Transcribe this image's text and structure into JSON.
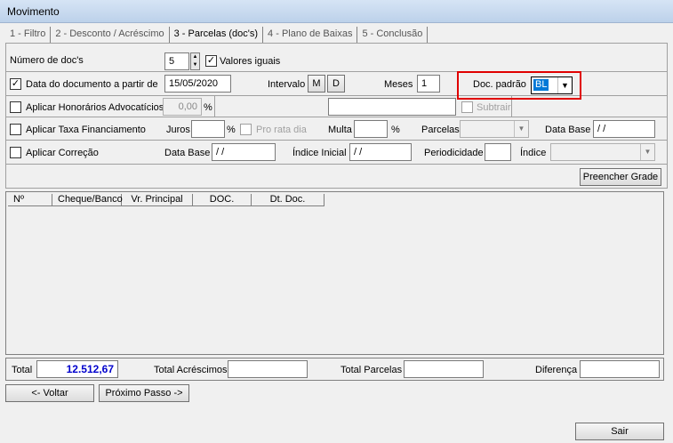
{
  "window": {
    "title": "Movimento"
  },
  "tabs": [
    {
      "label": "1 - Filtro"
    },
    {
      "label": "2 - Desconto / Acréscimo"
    },
    {
      "label": "3 - Parcelas (doc's)"
    },
    {
      "label": "4 - Plano de Baixas"
    },
    {
      "label": "5 - Conclusão"
    }
  ],
  "row1": {
    "num_docs_label": "Número de doc's",
    "num_docs_value": "5",
    "valores_iguais_label": "Valores iguais",
    "check_mark": "✓"
  },
  "row2": {
    "data_doc_label": "Data do documento a partir de",
    "data_doc_value": "15/05/2020",
    "intervalo_label": "Intervalo",
    "m_button": "M",
    "d_button": "D",
    "meses_label": "Meses",
    "meses_value": "1",
    "doc_padrao_label": "Doc. padrão",
    "doc_padrao_value": "BL"
  },
  "row3": {
    "honorarios_label": "Aplicar Honorários Advocatícios",
    "honorarios_value": "0,00",
    "percent": "%",
    "subtrair_label": "Subtrair"
  },
  "row4": {
    "taxa_label": "Aplicar Taxa Financiamento",
    "juros_label": "Juros",
    "percent": "%",
    "pro_rata_label": "Pro rata dia",
    "multa_label": "Multa",
    "parcelas_label": "Parcelas",
    "data_base_label": "Data Base",
    "data_base_value": " / /"
  },
  "row5": {
    "correcao_label": "Aplicar Correção",
    "data_base_label": "Data Base",
    "data_base_value": " / /",
    "indice_inicial_label": "Índice Inicial",
    "indice_inicial_value": " / /",
    "periodicidade_label": "Periodicidade",
    "indice_label": "Índice"
  },
  "preencher_button": "Preencher Grade",
  "grid": {
    "columns": [
      "Nº",
      "Cheque/Banco",
      "Vr. Principal",
      "DOC.",
      "Dt. Doc."
    ]
  },
  "totals": {
    "total_label": "Total",
    "total_value": "12.512,67",
    "acrescimos_label": "Total Acréscimos",
    "parcelas_label": "Total Parcelas",
    "diferenca_label": "Diferença"
  },
  "nav": {
    "voltar": "<- Voltar",
    "proximo": "Próximo Passo ->",
    "sair": "Sair"
  },
  "colors": {
    "total_value": "#0000cc",
    "highlight": "#e00000"
  }
}
